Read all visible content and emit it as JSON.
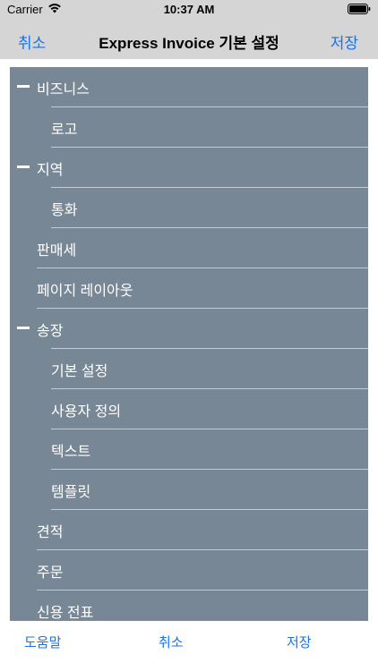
{
  "status": {
    "carrier": "Carrier",
    "time": "10:37 AM"
  },
  "nav": {
    "cancel": "취소",
    "title": "Express Invoice 기본 설정",
    "save": "저장"
  },
  "list": {
    "items": [
      {
        "label": "비즈니스",
        "level": 0,
        "expanded": true
      },
      {
        "label": "로고",
        "level": 1
      },
      {
        "label": "지역",
        "level": 0,
        "expanded": true
      },
      {
        "label": "통화",
        "level": 1
      },
      {
        "label": "판매세",
        "level": 0
      },
      {
        "label": "페이지 레이아웃",
        "level": 0
      },
      {
        "label": "송장",
        "level": 0,
        "expanded": true
      },
      {
        "label": "기본 설정",
        "level": 1
      },
      {
        "label": "사용자 정의",
        "level": 1
      },
      {
        "label": "텍스트",
        "level": 1
      },
      {
        "label": "템플릿",
        "level": 1
      },
      {
        "label": "견적",
        "level": 0
      },
      {
        "label": "주문",
        "level": 0
      },
      {
        "label": "신용 전표",
        "level": 0
      }
    ]
  },
  "toolbar": {
    "help": "도움말",
    "cancel": "취소",
    "save": "저장"
  },
  "colors": {
    "accent": "#1a73e8",
    "list_bg": "#788795",
    "bar_bg": "#d5d5d5"
  }
}
